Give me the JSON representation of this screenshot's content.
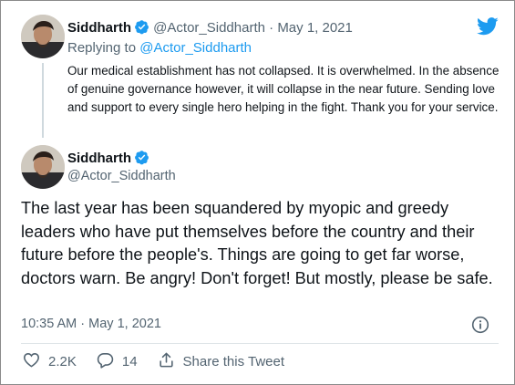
{
  "colors": {
    "brand": "#1d9bf0",
    "text": "#0f1419",
    "muted": "#536471"
  },
  "quoted_tweet": {
    "author_name": "Siddharth",
    "handle": "@Actor_Siddharth",
    "separator": "·",
    "date": "May 1, 2021",
    "replying_prefix": "Replying to",
    "replying_handle": "@Actor_Siddharth",
    "text": "Our medical establishment has not collapsed. It is overwhelmed. In the absence of genuine governance however, it will collapse in the near future. Sending love and support to every single hero helping in the fight. Thank you for your service."
  },
  "main_tweet": {
    "author_name": "Siddharth",
    "handle": "@Actor_Siddharth",
    "text": "The last year has been squandered by myopic and greedy leaders who have put themselves before the country and their future before the people's. Things are going to get far worse, doctors warn. Be angry! Don't forget! But mostly, please be safe.",
    "timestamp": "10:35 AM · May 1, 2021"
  },
  "actions": {
    "likes": "2.2K",
    "replies": "14",
    "share_label": "Share this Tweet"
  },
  "icons": {
    "logo": "twitter-bird-icon",
    "verified": "verified-badge-icon",
    "info": "info-icon",
    "like": "heart-icon",
    "reply": "reply-bubble-icon",
    "share": "share-icon"
  }
}
